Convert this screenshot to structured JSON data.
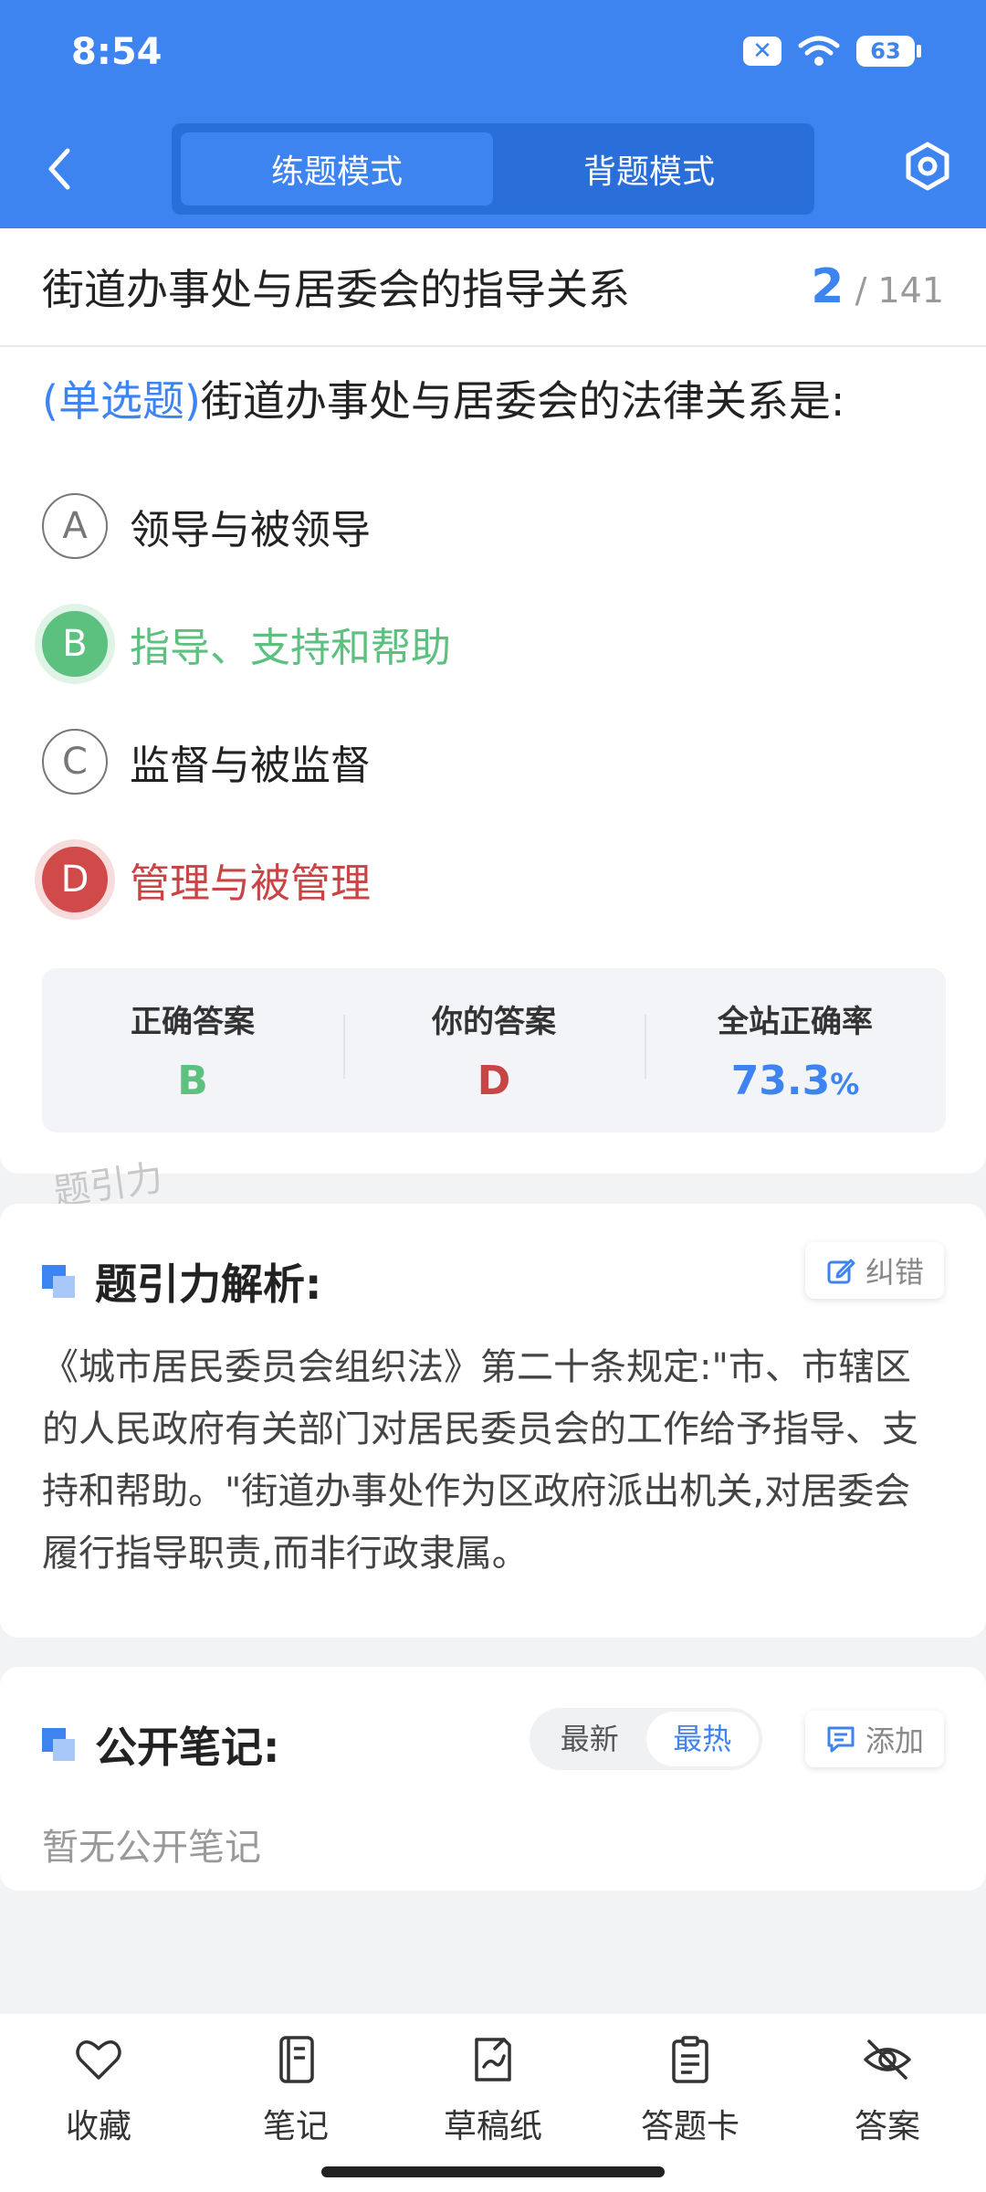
{
  "status_bar": {
    "time": "8:54",
    "notify_badge": "✕",
    "battery": "63"
  },
  "header": {
    "tabs": [
      {
        "label": "练题模式",
        "active": true
      },
      {
        "label": "背题模式",
        "active": false
      }
    ]
  },
  "question": {
    "title": "街道办事处与居委会的指导关系",
    "current": "2",
    "total": "/ 141",
    "type_label": "(单选题)",
    "text": "街道办事处与居委会的法律关系是:",
    "options": [
      {
        "letter": "A",
        "text": "领导与被领导",
        "state": "normal"
      },
      {
        "letter": "B",
        "text": "指导、支持和帮助",
        "state": "correct"
      },
      {
        "letter": "C",
        "text": "监督与被监督",
        "state": "normal"
      },
      {
        "letter": "D",
        "text": "管理与被管理",
        "state": "wrong"
      }
    ]
  },
  "answer_summary": {
    "correct_label": "正确答案",
    "correct_value": "B",
    "yours_label": "你的答案",
    "yours_value": "D",
    "rate_label": "全站正确率",
    "rate_value": "73.3",
    "rate_unit": "%"
  },
  "watermark": "题引力",
  "analysis": {
    "title": "题引力解析:",
    "report_label": "纠错",
    "body": "《城市居民委员会组织法》第二十条规定:\"市、市辖区的人民政府有关部门对居民委员会的工作给予指导、支持和帮助。\"街道办事处作为区政府派出机关,对居委会履行指导职责,而非行政隶属。"
  },
  "notes": {
    "title": "公开笔记:",
    "sort_options": [
      "最新",
      "最热"
    ],
    "add_label": "添加",
    "empty_text": "暂无公开笔记"
  },
  "bottom_nav": [
    {
      "label": "收藏",
      "icon": "heart-icon"
    },
    {
      "label": "笔记",
      "icon": "notebook-icon"
    },
    {
      "label": "草稿纸",
      "icon": "draft-paper-icon"
    },
    {
      "label": "答题卡",
      "icon": "answer-card-icon"
    },
    {
      "label": "答案",
      "icon": "eye-off-icon"
    }
  ],
  "colors": {
    "primary": "#3d84f0",
    "correct": "#5cc07f",
    "wrong": "#c94545"
  }
}
